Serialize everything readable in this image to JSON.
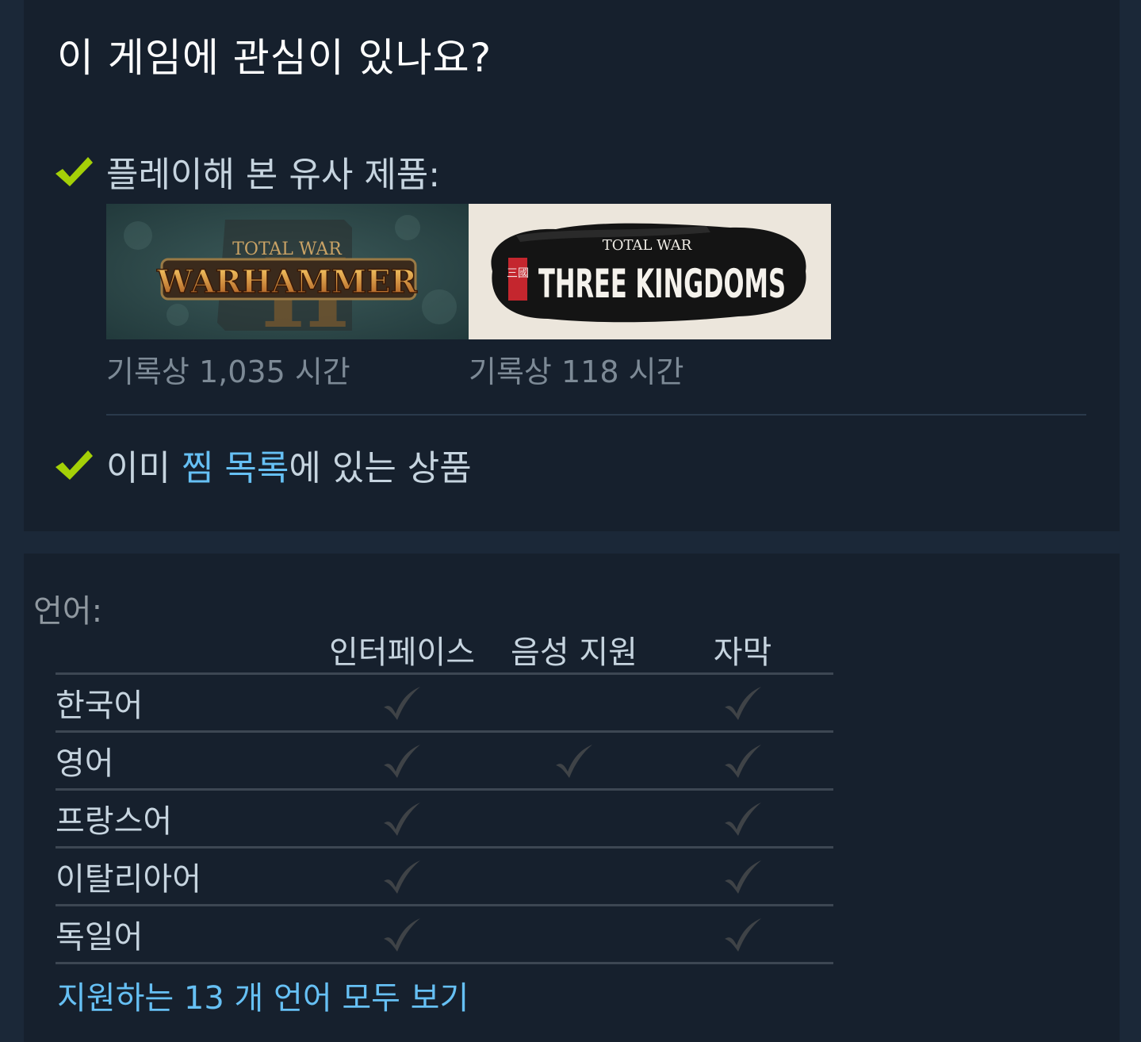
{
  "interest": {
    "title": "이 게임에 관심이 있나요?",
    "similar_played_label": "플레이해 본 유사 제품:",
    "games": [
      {
        "logo_small": "TOTAL WAR",
        "logo_main": "WARHAMMER",
        "logo_numeral": "II",
        "hours": "기록상 1,035 시간"
      },
      {
        "logo_small": "TOTAL WAR",
        "logo_main": "THREE KINGDOMS",
        "logo_seal": "三國",
        "hours": "기록상 118 시간"
      }
    ],
    "wishlist": {
      "prefix": "이미 ",
      "link": "찜 목록",
      "suffix": "에 있는 상품"
    }
  },
  "languages": {
    "heading": "언어:",
    "columns": [
      "인터페이스",
      "음성 지원",
      "자막"
    ],
    "rows": [
      {
        "name": "한국어",
        "interface": true,
        "audio": false,
        "subtitles": true
      },
      {
        "name": "영어",
        "interface": true,
        "audio": true,
        "subtitles": true
      },
      {
        "name": "프랑스어",
        "interface": true,
        "audio": false,
        "subtitles": true
      },
      {
        "name": "이탈리아어",
        "interface": true,
        "audio": false,
        "subtitles": true
      },
      {
        "name": "독일어",
        "interface": true,
        "audio": false,
        "subtitles": true
      }
    ],
    "show_all_link": "지원하는 13 개 언어 모두 보기"
  },
  "colors": {
    "background": "#1b2838",
    "panel": "#16202d",
    "check_green": "#a4d007",
    "link_blue": "#66c0f4",
    "tick_gray": "#3f4347"
  }
}
